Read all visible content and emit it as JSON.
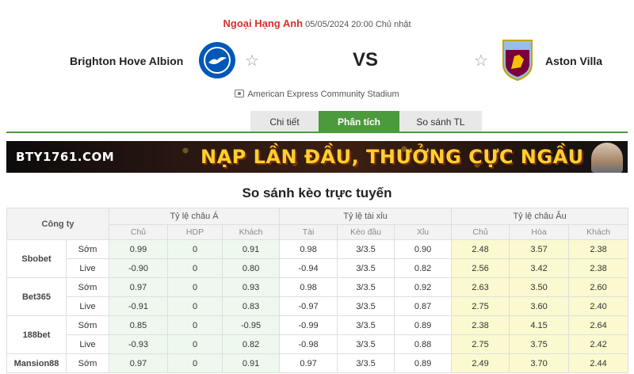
{
  "match": {
    "league": "Ngoại Hạng Anh",
    "datetime": "05/05/2024 20:00 Chủ nhật",
    "home_team": "Brighton Hove Albion",
    "away_team": "Aston Villa",
    "vs": "VS",
    "stadium": "American Express Community Stadium"
  },
  "tabs": [
    "Chi tiết",
    "Phân tích",
    "So sánh TL"
  ],
  "active_tab": "Phân tích",
  "banner": {
    "brand": "BTY1761.COM",
    "slogan": "NẠP LẦN ĐẦU, THƯỞNG CỰC NGẦU"
  },
  "section_title": "So sánh kèo trực tuyến",
  "table": {
    "company_header": "Công ty",
    "groups": [
      "Tỷ lệ châu Á",
      "Tỷ lệ tài xỉu",
      "Tỷ lệ châu Âu"
    ],
    "subheaders": [
      "Chủ",
      "HDP",
      "Khách",
      "Tài",
      "Kèo đầu",
      "Xỉu",
      "Chủ",
      "Hòa",
      "Khách"
    ],
    "companies": [
      {
        "name": "Sbobet",
        "rows": [
          {
            "type": "Sớm",
            "values": [
              "0.99",
              "0",
              "0.91",
              "0.98",
              "3/3.5",
              "0.90",
              "2.48",
              "3.57",
              "2.38"
            ]
          },
          {
            "type": "Live",
            "values": [
              "-0.90",
              "0",
              "0.80",
              "-0.94",
              "3/3.5",
              "0.82",
              "2.56",
              "3.42",
              "2.38"
            ]
          }
        ]
      },
      {
        "name": "Bet365",
        "rows": [
          {
            "type": "Sớm",
            "values": [
              "0.97",
              "0",
              "0.93",
              "0.98",
              "3/3.5",
              "0.92",
              "2.63",
              "3.50",
              "2.60"
            ]
          },
          {
            "type": "Live",
            "values": [
              "-0.91",
              "0",
              "0.83",
              "-0.97",
              "3/3.5",
              "0.87",
              "2.75",
              "3.60",
              "2.40"
            ]
          }
        ]
      },
      {
        "name": "188bet",
        "rows": [
          {
            "type": "Sớm",
            "values": [
              "0.85",
              "0",
              "-0.95",
              "-0.99",
              "3/3.5",
              "0.89",
              "2.38",
              "4.15",
              "2.64"
            ]
          },
          {
            "type": "Live",
            "values": [
              "-0.93",
              "0",
              "0.82",
              "-0.98",
              "3/3.5",
              "0.88",
              "2.75",
              "3.75",
              "2.42"
            ]
          }
        ]
      },
      {
        "name": "Mansion88",
        "rows": [
          {
            "type": "Sớm",
            "values": [
              "0.97",
              "0",
              "0.91",
              "0.97",
              "3/3.5",
              "0.89",
              "2.49",
              "3.70",
              "2.44"
            ]
          }
        ]
      }
    ]
  },
  "colors": {
    "league_red": "#d9302b",
    "tab_active_green": "#4c9a3e",
    "asia_bg": "#eef8ee",
    "europe_bg": "#fbf9cf"
  }
}
